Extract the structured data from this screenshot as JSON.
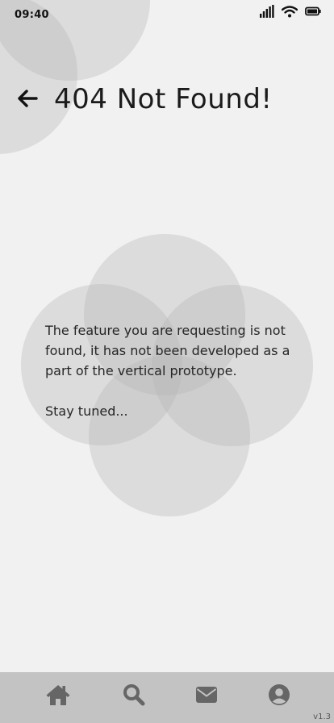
{
  "status_bar": {
    "time": "09:40",
    "icons": [
      "signal-icon",
      "wifi-icon",
      "battery-icon"
    ]
  },
  "header": {
    "back_icon": "arrow-left-icon",
    "title": "404 Not Found!"
  },
  "message": {
    "line1": "The feature you are requesting is not found, it has not been developed as a part of the vertical prototype.",
    "line2": "Stay tuned..."
  },
  "nav": {
    "items": [
      {
        "icon": "home-icon"
      },
      {
        "icon": "search-icon"
      },
      {
        "icon": "mail-icon"
      },
      {
        "icon": "profile-icon"
      }
    ],
    "version": "v1.3"
  },
  "colors": {
    "background": "#f1f1f1",
    "nav_background": "#c3c3c3",
    "nav_icon": "#666666",
    "text": "#1b1b1b"
  }
}
